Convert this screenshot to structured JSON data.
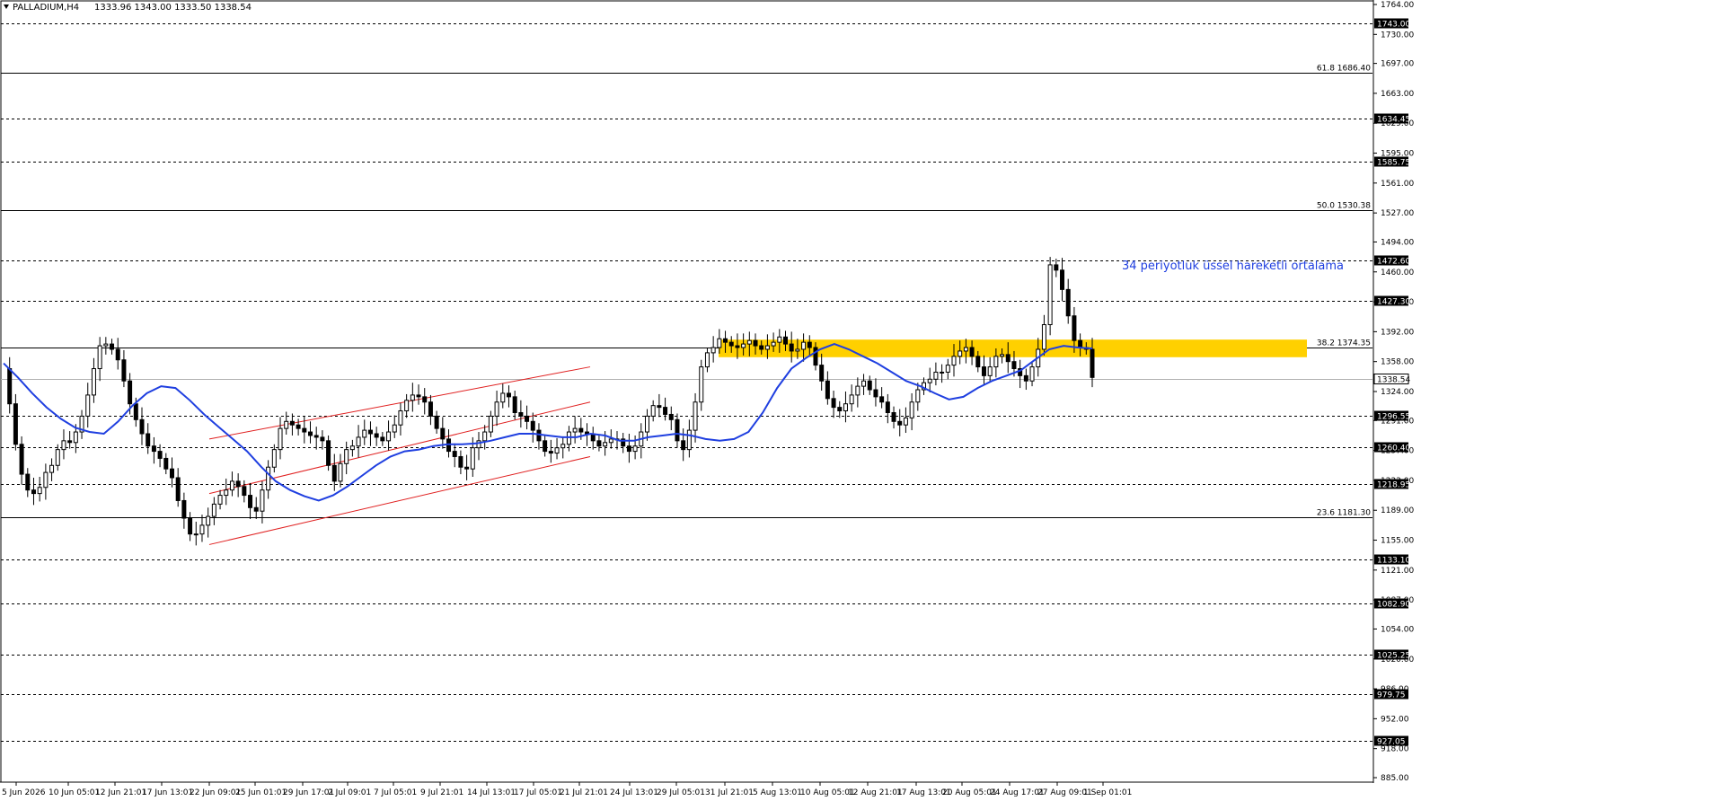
{
  "header": {
    "symbol": "PALLADIUM,H4",
    "ohlc": "1333.96 1343.00 1333.50 1338.54"
  },
  "chart_data": {
    "type": "candlestick",
    "symbol": "PALLADIUM",
    "timeframe": "H4",
    "ohlc_current": {
      "open": 1333.96,
      "high": 1343.0,
      "low": 1333.5,
      "close": 1338.54
    },
    "current_price": 1338.54,
    "ylim": [
      885.0,
      1764.0
    ],
    "y_ticks": [
      "1764.00",
      "1730.00",
      "1697.00",
      "1663.00",
      "1629.00",
      "1595.00",
      "1561.00",
      "1527.00",
      "1494.00",
      "1460.00",
      "1426.00",
      "1392.00",
      "1358.00",
      "1324.00",
      "1291.00",
      "1257.00",
      "1223.00",
      "1189.00",
      "1155.00",
      "1121.00",
      "1087.00",
      "1054.00",
      "1020.00",
      "986.00",
      "952.00",
      "918.00",
      "885.00"
    ],
    "x_ticks": [
      "5 Jun 2026",
      "10 Jun 05:01",
      "12 Jun 21:01",
      "17 Jun 13:01",
      "22 Jun 09:01",
      "25 Jun 01:01",
      "29 Jun 17:01",
      "2 Jul 09:01",
      "7 Jul 05:01",
      "9 Jul 21:01",
      "14 Jul 13:01",
      "17 Jul 05:01",
      "21 Jul 21:01",
      "24 Jul 13:01",
      "29 Jul 05:01",
      "31 Jul 21:01",
      "5 Aug 13:01",
      "10 Aug 05:01",
      "12 Aug 21:01",
      "17 Aug 13:01",
      "20 Aug 05:01",
      "24 Aug 17:01",
      "27 Aug 09:01",
      "1 Sep 01:01"
    ],
    "levels": [
      {
        "price": 1743.0,
        "label": "1743.00"
      },
      {
        "price": 1634.45,
        "label": "1634.45"
      },
      {
        "price": 1585.75,
        "label": "1585.75"
      },
      {
        "price": 1472.6,
        "label": "1472.60"
      },
      {
        "price": 1427.3,
        "label": "1427.30"
      },
      {
        "price": 1296.55,
        "label": "1296.55"
      },
      {
        "price": 1260.4,
        "label": "1260.40"
      },
      {
        "price": 1218.95,
        "label": "1218.95"
      },
      {
        "price": 1133.1,
        "label": "1133.10"
      },
      {
        "price": 1082.9,
        "label": "1082.90"
      },
      {
        "price": 1025.25,
        "label": "1025.25"
      },
      {
        "price": 979.75,
        "label": "979.75"
      },
      {
        "price": 927.05,
        "label": "927.05"
      }
    ],
    "fib_levels": [
      {
        "price": 1686.4,
        "label": "61.8 1686.40"
      },
      {
        "price": 1530.38,
        "label": "50.0 1530.38"
      },
      {
        "price": 1374.35,
        "label": "38.2 1374.35"
      },
      {
        "price": 1181.3,
        "label": "23.6 1181.30"
      }
    ],
    "zone": {
      "from_price": 1363,
      "to_price": 1383,
      "color": "#ffd000"
    },
    "channel": {
      "upper": [
        [
          "22 Jun 09:01",
          1270
        ],
        [
          "21 Jul 21:01",
          1352
        ]
      ],
      "middle": [
        [
          "22 Jun 09:01",
          1208
        ],
        [
          "21 Jul 21:01",
          1312
        ]
      ],
      "lower": [
        [
          "22 Jun 09:01",
          1150
        ],
        [
          "21 Jul 21:01",
          1250
        ]
      ],
      "color": "#e02020"
    },
    "ema_series": [
      1356,
      1340,
      1322,
      1306,
      1293,
      1283,
      1278,
      1276,
      1290,
      1308,
      1322,
      1330,
      1328,
      1314,
      1298,
      1284,
      1270,
      1256,
      1238,
      1222,
      1212,
      1205,
      1200,
      1206,
      1216,
      1228,
      1240,
      1250,
      1256,
      1258,
      1262,
      1264,
      1264,
      1265,
      1268,
      1272,
      1276,
      1276,
      1274,
      1272,
      1272,
      1276,
      1274,
      1268,
      1268,
      1272,
      1274,
      1276,
      1274,
      1270,
      1268,
      1270,
      1278,
      1300,
      1328,
      1350,
      1362,
      1372,
      1378,
      1372,
      1364,
      1356,
      1346,
      1336,
      1330,
      1322,
      1315,
      1318,
      1328,
      1336,
      1342,
      1348,
      1360,
      1372,
      1376,
      1374,
      1373
    ],
    "price_series": [
      1350,
      1310,
      1264,
      1230,
      1212,
      1208,
      1215,
      1232,
      1240,
      1258,
      1268,
      1266,
      1278,
      1296,
      1320,
      1350,
      1376,
      1378,
      1372,
      1360,
      1336,
      1310,
      1292,
      1276,
      1262,
      1256,
      1248,
      1236,
      1226,
      1200,
      1180,
      1162,
      1162,
      1172,
      1182,
      1196,
      1206,
      1212,
      1222,
      1216,
      1206,
      1192,
      1188,
      1212,
      1238,
      1258,
      1282,
      1290,
      1286,
      1282,
      1278,
      1274,
      1272,
      1268,
      1240,
      1222,
      1242,
      1258,
      1262,
      1272,
      1280,
      1276,
      1272,
      1268,
      1278,
      1286,
      1302,
      1314,
      1320,
      1318,
      1312,
      1296,
      1282,
      1270,
      1256,
      1250,
      1238,
      1236,
      1260,
      1268,
      1278,
      1296,
      1312,
      1322,
      1318,
      1300,
      1296,
      1290,
      1280,
      1268,
      1256,
      1254,
      1260,
      1264,
      1278,
      1282,
      1278,
      1276,
      1268,
      1262,
      1266,
      1270,
      1270,
      1262,
      1256,
      1262,
      1278,
      1296,
      1308,
      1306,
      1298,
      1292,
      1268,
      1258,
      1280,
      1312,
      1352,
      1368,
      1374,
      1384,
      1380,
      1376,
      1374,
      1378,
      1382,
      1376,
      1372,
      1376,
      1380,
      1386,
      1378,
      1370,
      1372,
      1380,
      1374,
      1354,
      1336,
      1316,
      1306,
      1302,
      1310,
      1320,
      1330,
      1336,
      1326,
      1318,
      1312,
      1300,
      1290,
      1286,
      1294,
      1312,
      1326,
      1334,
      1338,
      1346,
      1346,
      1354,
      1364,
      1370,
      1374,
      1364,
      1352,
      1342,
      1352,
      1364,
      1366,
      1358,
      1350,
      1342,
      1336,
      1352,
      1372,
      1400,
      1468,
      1462,
      1440,
      1410,
      1382,
      1374,
      1372,
      1340
    ]
  },
  "annotation": {
    "text": "34 periyotluk üssel hareketli ortalama",
    "color": "#1f3fe0"
  },
  "colors": {
    "ema": "#1f3fe0",
    "candle": "#000000",
    "level_line": "#000000",
    "current_price_line": "#b0b0b0",
    "zone": "#ffd000",
    "channel": "#e02020"
  }
}
